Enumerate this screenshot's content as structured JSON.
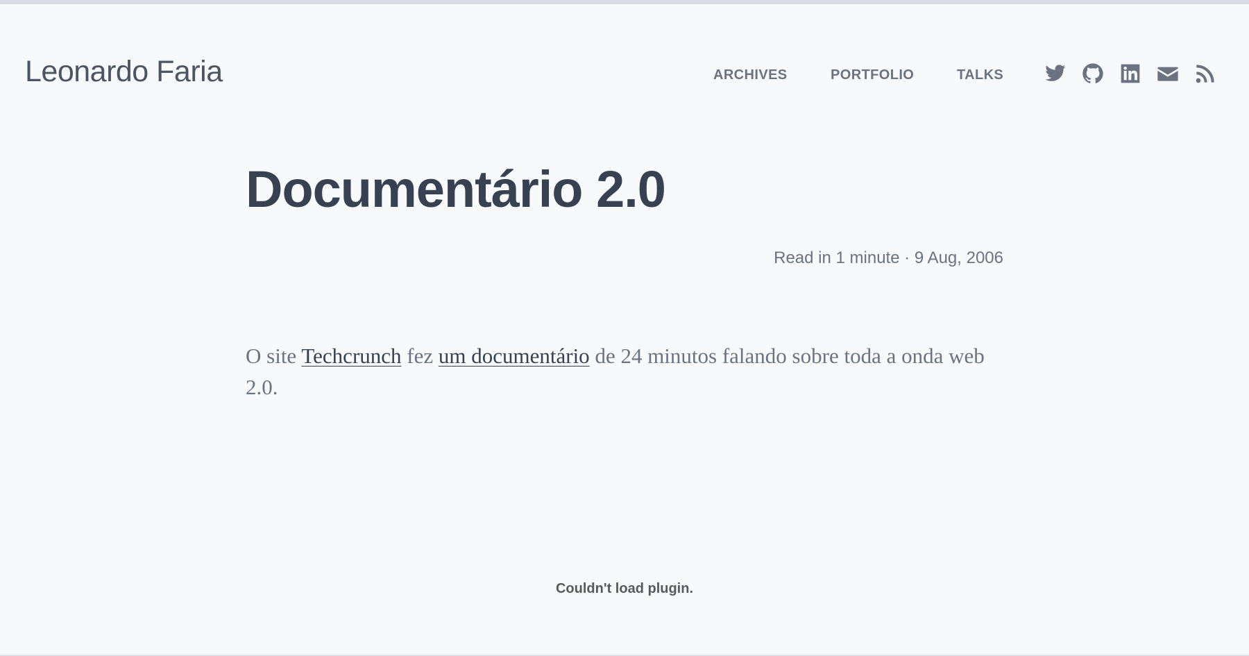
{
  "site": {
    "title": "Leonardo Faria"
  },
  "nav": {
    "items": [
      {
        "label": "ARCHIVES"
      },
      {
        "label": "PORTFOLIO"
      },
      {
        "label": "TALKS"
      }
    ]
  },
  "social": {
    "icons": [
      "twitter-icon",
      "github-icon",
      "linkedin-icon",
      "email-icon",
      "rss-icon"
    ],
    "icon_color": "#6b7280"
  },
  "post": {
    "title": "Documentário 2.0",
    "meta": "Read in 1 minute · 9 Aug, 2006",
    "body": {
      "text_1": "O site ",
      "link_1": "Techcrunch",
      "text_2": " fez ",
      "link_2": "um documentário",
      "text_3": " de 24 minutos falando sobre toda a onda web 2.0."
    }
  },
  "plugin": {
    "message": "Couldn't load plugin."
  },
  "colors": {
    "background": "#f8f9fb",
    "heading": "#374151",
    "muted": "#6b7280"
  }
}
